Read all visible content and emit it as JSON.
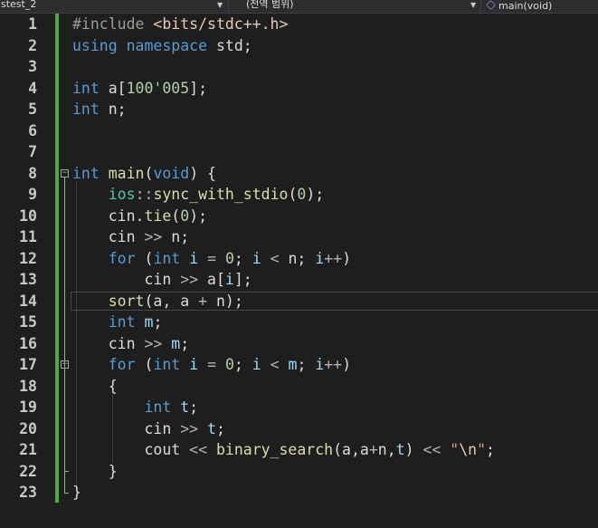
{
  "navigation_bar": {
    "project": "stest_2",
    "scope": "(전역 범위)",
    "member": "main(void)"
  },
  "editor": {
    "lines": [
      {
        "num": "1",
        "tokens": [
          {
            "t": "#include ",
            "c": "pp"
          },
          {
            "t": "<bits/stdc++.h>",
            "c": "inc"
          }
        ]
      },
      {
        "num": "2",
        "tokens": [
          {
            "t": "using",
            "c": "kw"
          },
          {
            "t": " ",
            "c": "pl"
          },
          {
            "t": "namespace",
            "c": "kw"
          },
          {
            "t": " std;",
            "c": "pl"
          }
        ]
      },
      {
        "num": "3",
        "tokens": []
      },
      {
        "num": "4",
        "tokens": [
          {
            "t": "int",
            "c": "kw"
          },
          {
            "t": " a[",
            "c": "pl"
          },
          {
            "t": "100'005",
            "c": "num"
          },
          {
            "t": "];",
            "c": "pl"
          }
        ]
      },
      {
        "num": "5",
        "tokens": [
          {
            "t": "int",
            "c": "kw"
          },
          {
            "t": " n;",
            "c": "pl"
          }
        ]
      },
      {
        "num": "6",
        "tokens": []
      },
      {
        "num": "7",
        "tokens": []
      },
      {
        "num": "8",
        "tokens": [
          {
            "t": "int",
            "c": "kw"
          },
          {
            "t": " ",
            "c": "pl"
          },
          {
            "t": "main",
            "c": "fn"
          },
          {
            "t": "(",
            "c": "pl"
          },
          {
            "t": "void",
            "c": "kw"
          },
          {
            "t": ") {",
            "c": "pl"
          }
        ]
      },
      {
        "num": "9",
        "tokens": [
          {
            "t": "    ",
            "c": "pl"
          },
          {
            "t": "ios",
            "c": "ns"
          },
          {
            "t": "::",
            "c": "op"
          },
          {
            "t": "sync_with_stdio",
            "c": "fn"
          },
          {
            "t": "(",
            "c": "pl"
          },
          {
            "t": "0",
            "c": "num"
          },
          {
            "t": ");",
            "c": "pl"
          }
        ]
      },
      {
        "num": "10",
        "tokens": [
          {
            "t": "    cin.",
            "c": "pl"
          },
          {
            "t": "tie",
            "c": "fn"
          },
          {
            "t": "(",
            "c": "pl"
          },
          {
            "t": "0",
            "c": "num"
          },
          {
            "t": ");",
            "c": "pl"
          }
        ]
      },
      {
        "num": "11",
        "tokens": [
          {
            "t": "    cin ",
            "c": "pl"
          },
          {
            "t": ">>",
            "c": "op"
          },
          {
            "t": " n;",
            "c": "pl"
          }
        ]
      },
      {
        "num": "12",
        "tokens": [
          {
            "t": "    ",
            "c": "pl"
          },
          {
            "t": "for",
            "c": "kw"
          },
          {
            "t": " (",
            "c": "pl"
          },
          {
            "t": "int",
            "c": "kw"
          },
          {
            "t": " ",
            "c": "pl"
          },
          {
            "t": "i",
            "c": "lv"
          },
          {
            "t": " ",
            "c": "pl"
          },
          {
            "t": "=",
            "c": "op"
          },
          {
            "t": " ",
            "c": "pl"
          },
          {
            "t": "0",
            "c": "num"
          },
          {
            "t": "; ",
            "c": "pl"
          },
          {
            "t": "i",
            "c": "lv"
          },
          {
            "t": " ",
            "c": "pl"
          },
          {
            "t": "<",
            "c": "op"
          },
          {
            "t": " n; ",
            "c": "pl"
          },
          {
            "t": "i",
            "c": "lv"
          },
          {
            "t": "++",
            "c": "op"
          },
          {
            "t": ")",
            "c": "pl"
          }
        ]
      },
      {
        "num": "13",
        "tokens": [
          {
            "t": "        cin ",
            "c": "pl"
          },
          {
            "t": ">>",
            "c": "op"
          },
          {
            "t": " a[",
            "c": "pl"
          },
          {
            "t": "i",
            "c": "lv"
          },
          {
            "t": "];",
            "c": "pl"
          }
        ]
      },
      {
        "num": "14",
        "tokens": [
          {
            "t": "    ",
            "c": "pl"
          },
          {
            "t": "sort",
            "c": "fn"
          },
          {
            "t": "(a, a ",
            "c": "pl"
          },
          {
            "t": "+",
            "c": "op"
          },
          {
            "t": " n);",
            "c": "pl"
          }
        ]
      },
      {
        "num": "15",
        "tokens": [
          {
            "t": "    ",
            "c": "pl"
          },
          {
            "t": "int",
            "c": "kw"
          },
          {
            "t": " ",
            "c": "pl"
          },
          {
            "t": "m",
            "c": "lv"
          },
          {
            "t": ";",
            "c": "pl"
          }
        ]
      },
      {
        "num": "16",
        "tokens": [
          {
            "t": "    cin ",
            "c": "pl"
          },
          {
            "t": ">>",
            "c": "op"
          },
          {
            "t": " ",
            "c": "pl"
          },
          {
            "t": "m",
            "c": "lv"
          },
          {
            "t": ";",
            "c": "pl"
          }
        ]
      },
      {
        "num": "17",
        "tokens": [
          {
            "t": "    ",
            "c": "pl"
          },
          {
            "t": "for",
            "c": "kw"
          },
          {
            "t": " (",
            "c": "pl"
          },
          {
            "t": "int",
            "c": "kw"
          },
          {
            "t": " ",
            "c": "pl"
          },
          {
            "t": "i",
            "c": "lv"
          },
          {
            "t": " ",
            "c": "pl"
          },
          {
            "t": "=",
            "c": "op"
          },
          {
            "t": " ",
            "c": "pl"
          },
          {
            "t": "0",
            "c": "num"
          },
          {
            "t": "; ",
            "c": "pl"
          },
          {
            "t": "i",
            "c": "lv"
          },
          {
            "t": " ",
            "c": "pl"
          },
          {
            "t": "<",
            "c": "op"
          },
          {
            "t": " ",
            "c": "pl"
          },
          {
            "t": "m",
            "c": "lv"
          },
          {
            "t": "; ",
            "c": "pl"
          },
          {
            "t": "i",
            "c": "lv"
          },
          {
            "t": "++",
            "c": "op"
          },
          {
            "t": ")",
            "c": "pl"
          }
        ]
      },
      {
        "num": "18",
        "tokens": [
          {
            "t": "    {",
            "c": "pl"
          }
        ]
      },
      {
        "num": "19",
        "tokens": [
          {
            "t": "        ",
            "c": "pl"
          },
          {
            "t": "int",
            "c": "kw"
          },
          {
            "t": " ",
            "c": "pl"
          },
          {
            "t": "t",
            "c": "lv"
          },
          {
            "t": ";",
            "c": "pl"
          }
        ]
      },
      {
        "num": "20",
        "tokens": [
          {
            "t": "        cin ",
            "c": "pl"
          },
          {
            "t": ">>",
            "c": "op"
          },
          {
            "t": " ",
            "c": "pl"
          },
          {
            "t": "t",
            "c": "lv"
          },
          {
            "t": ";",
            "c": "pl"
          }
        ]
      },
      {
        "num": "21",
        "tokens": [
          {
            "t": "        cout ",
            "c": "pl"
          },
          {
            "t": "<<",
            "c": "op"
          },
          {
            "t": " ",
            "c": "pl"
          },
          {
            "t": "binary_search",
            "c": "fn"
          },
          {
            "t": "(a,a",
            "c": "pl"
          },
          {
            "t": "+",
            "c": "op"
          },
          {
            "t": "n,",
            "c": "pl"
          },
          {
            "t": "t",
            "c": "lv"
          },
          {
            "t": ") ",
            "c": "pl"
          },
          {
            "t": "<<",
            "c": "op"
          },
          {
            "t": " ",
            "c": "pl"
          },
          {
            "t": "\"",
            "c": "str"
          },
          {
            "t": "\\n",
            "c": "esc"
          },
          {
            "t": "\"",
            "c": "str"
          },
          {
            "t": ";",
            "c": "pl"
          }
        ]
      },
      {
        "num": "22",
        "tokens": [
          {
            "t": "    }",
            "c": "pl"
          }
        ]
      },
      {
        "num": "23",
        "tokens": [
          {
            "t": "}",
            "c": "pl"
          }
        ]
      }
    ],
    "current_line": "14",
    "folds": [
      "8",
      "17"
    ]
  },
  "colors": {
    "background": "#1e1e1e",
    "keyword": "#569cd6",
    "function": "#dcdcaa",
    "number": "#b5cea8",
    "change_bar": "#57a64a"
  }
}
